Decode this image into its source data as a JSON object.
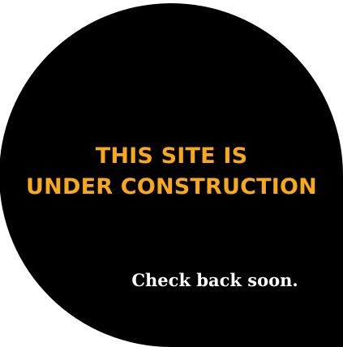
{
  "headline": {
    "line1": "THIS SITE IS",
    "line2": "UNDER CONSTRUCTION"
  },
  "subline": "Check back soon.",
  "colors": {
    "background": "#ffffff",
    "badge": "#000000",
    "headline": "#f7a81b",
    "subline": "#ffffff"
  }
}
